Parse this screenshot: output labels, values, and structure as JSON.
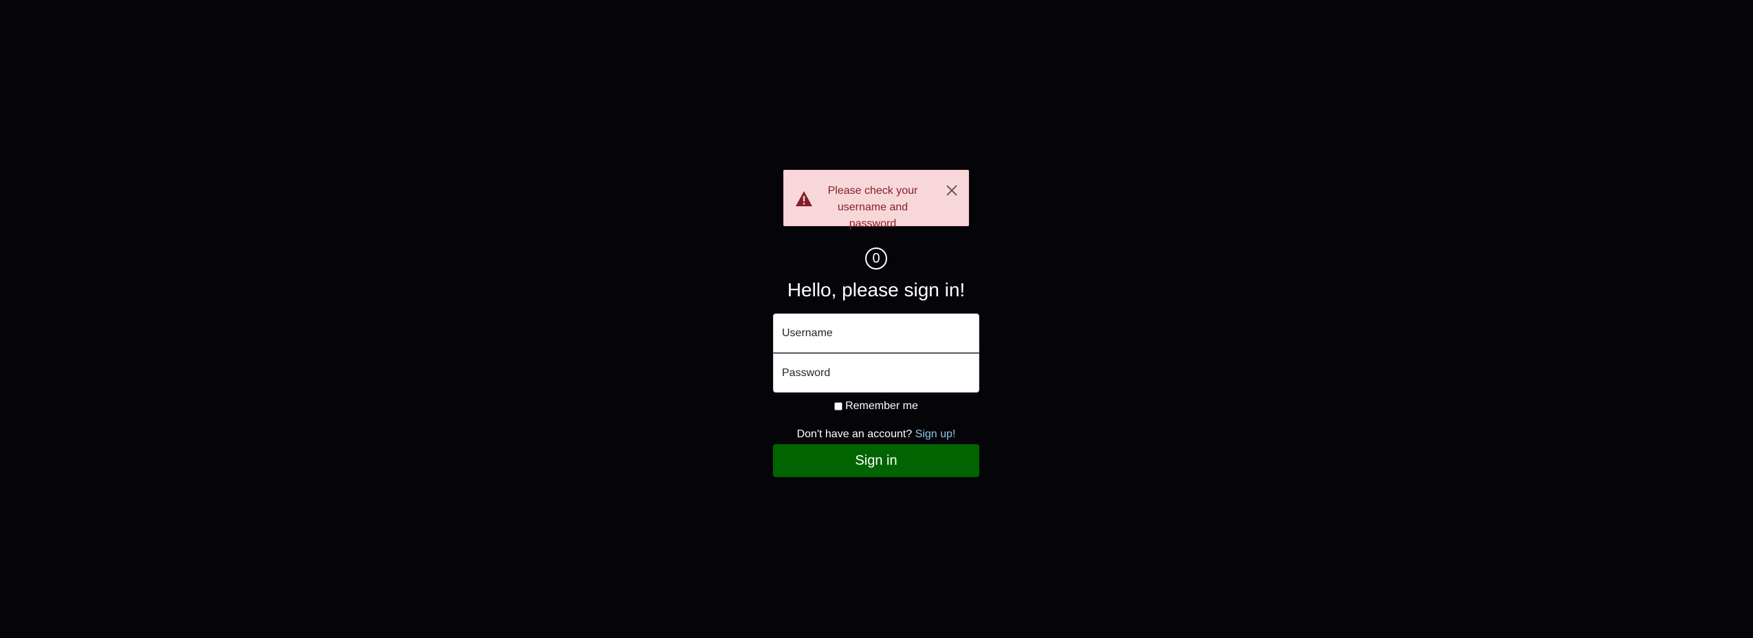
{
  "alert": {
    "message": "Please check your username and password",
    "icon": "warning-triangle-icon",
    "close_icon": "close-icon",
    "colors": {
      "background": "#f8d7da",
      "text": "#842029"
    }
  },
  "logo": {
    "text": "0"
  },
  "title": "Hello, please sign in!",
  "form": {
    "username_placeholder": "Username",
    "password_placeholder": "Password",
    "remember_label": "Remember me",
    "remember_checked": false
  },
  "signup": {
    "prompt": "Don't have an account?",
    "link_label": "Sign up!"
  },
  "signin_button": {
    "label": "Sign in",
    "color": "#006400"
  }
}
